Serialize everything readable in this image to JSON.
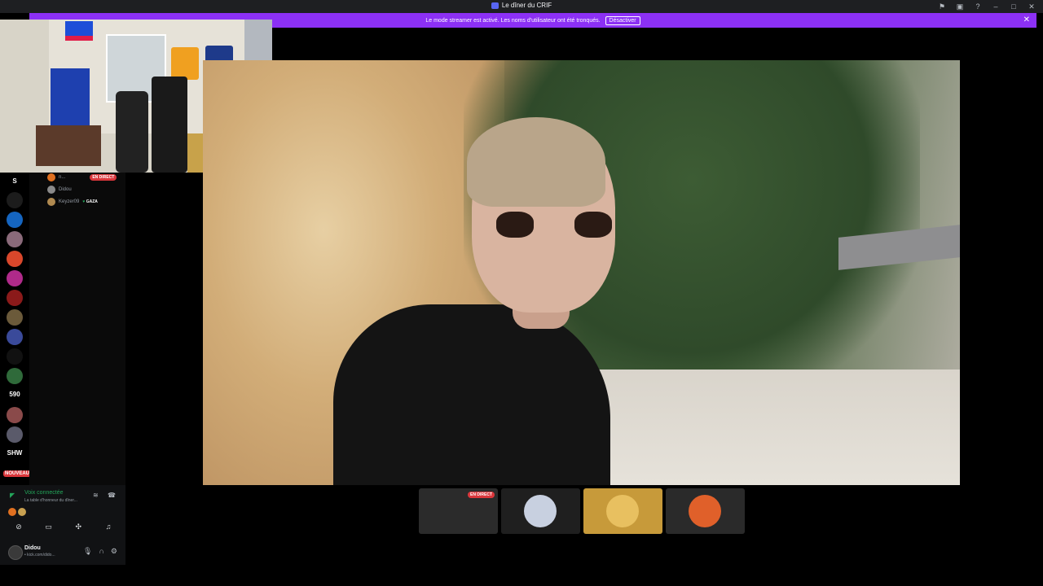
{
  "window": {
    "title": "Le dîner du CRIF"
  },
  "banner": {
    "message": "Le mode streamer est activé. Les noms d'utilisateur ont été tronqués.",
    "button_label": "Désactiver"
  },
  "guild_labels": {
    "s": "S",
    "n590": "590",
    "shw": "SHW",
    "nouveau": "NOUVEAU"
  },
  "voice_users": [
    {
      "name": "n...",
      "badge": "EN DIRECT"
    },
    {
      "name": "Didou"
    },
    {
      "name": "Keyzer09",
      "status": "GAZA"
    }
  ],
  "voice_panel": {
    "status": "Voix connectée",
    "channel": "La table d'honneur du dîner..."
  },
  "user": {
    "name": "Didou",
    "status": "• kick.com/dido..."
  },
  "tiles": [
    {
      "badge": "EN DIRECT",
      "color": "#2b2b2b"
    },
    {
      "color": "#1f1f1f"
    },
    {
      "color": "#c79a3a"
    },
    {
      "color": "#2a2a2a"
    }
  ],
  "colors": {
    "accent_banner": "#8c30f5",
    "live_red": "#da373c",
    "voice_green": "#23a55a"
  },
  "icons": {
    "titlebar": [
      "pin-icon",
      "inbox-icon",
      "help-icon",
      "minimize-icon",
      "maximize-icon",
      "close-icon"
    ],
    "actions": [
      "camera-off-icon",
      "screen-share-icon",
      "activities-icon",
      "soundboard-icon"
    ],
    "user_controls": [
      "microphone-icon",
      "headset-icon",
      "settings-icon"
    ]
  }
}
